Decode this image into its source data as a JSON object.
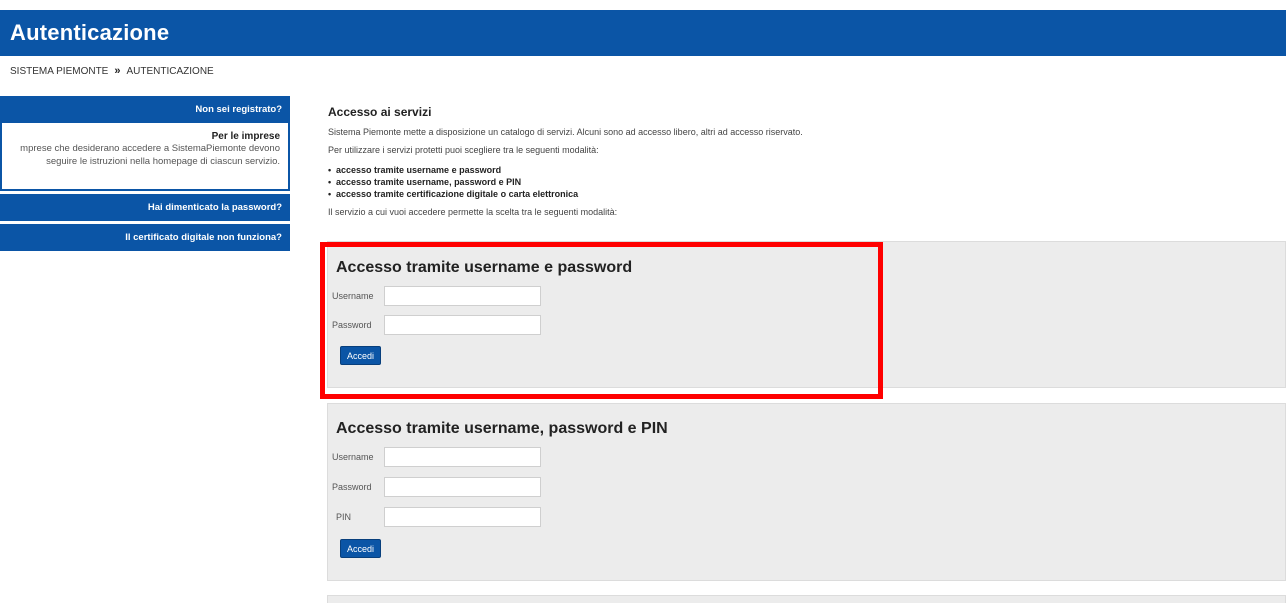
{
  "header": {
    "title": "Autenticazione"
  },
  "breadcrumb": {
    "items": [
      "SISTEMA PIEMONTE",
      "AUTENTICAZIONE"
    ],
    "separator": "»"
  },
  "sidebar": {
    "not_registered": "Non sei registrato?",
    "businesses_title": "Per le imprese",
    "businesses_line1": "mprese che desiderano accedere a SistemaPiemonte devono",
    "businesses_line2": "seguire le istruzioni nella homepage di ciascun servizio.",
    "forgot_password": "Hai dimenticato la password?",
    "certificate_issue": "Il certificato digitale non funziona?"
  },
  "main": {
    "title": "Accesso ai servizi",
    "intro": "Sistema Piemonte mette a disposizione un catalogo di servizi. Alcuni sono ad accesso libero, altri ad accesso riservato.",
    "choose": "Per utilizzare i servizi protetti puoi scegliere tra le seguenti modalità:",
    "modes": [
      "accesso tramite username e password",
      "accesso tramite username, password e PIN",
      "accesso tramite certificazione digitale o carta elettronica"
    ],
    "service_choice": "Il servizio a cui vuoi accedere permette la scelta tra le seguenti modalità:"
  },
  "panel1": {
    "title": "Accesso tramite username e password",
    "username_label": "Username",
    "username_value": "",
    "password_label": "Password",
    "password_value": "",
    "submit": "Accedi"
  },
  "panel2": {
    "title": "Accesso tramite username, password e PIN",
    "username_label": "Username",
    "username_value": "",
    "password_label": "Password",
    "password_value": "",
    "pin_label": "PIN",
    "pin_value": "",
    "submit": "Accedi"
  },
  "colors": {
    "brand": "#0b55a6",
    "highlight": "#ff0000",
    "panel_bg": "#ececec"
  }
}
